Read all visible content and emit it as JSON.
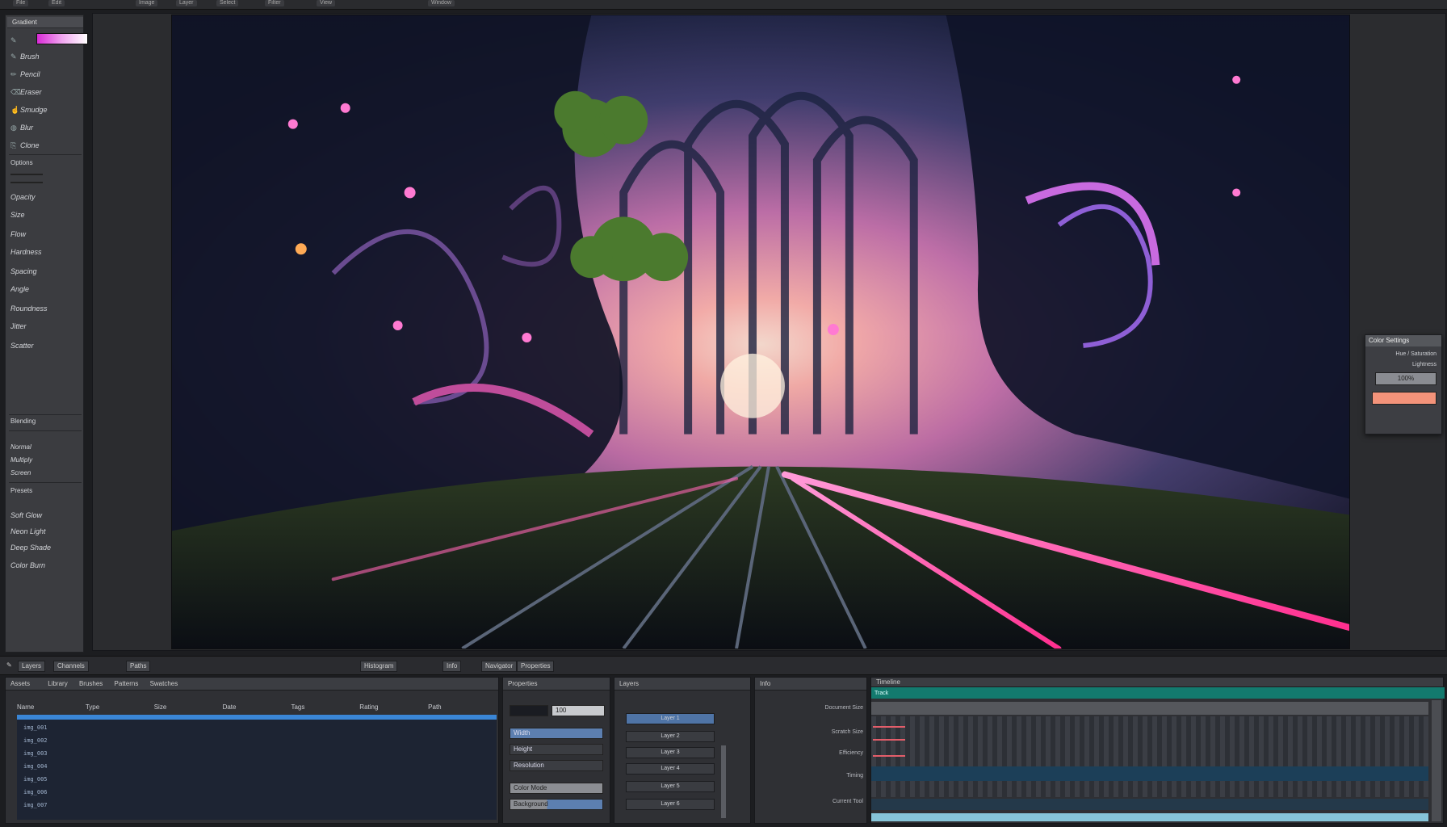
{
  "menubar": {
    "items": [
      "File",
      "Edit",
      "Image",
      "Layer",
      "Select",
      "Filter",
      "View",
      "Window"
    ]
  },
  "left_panel": {
    "header": "Gradient",
    "tools": [
      {
        "icon": "brush-icon",
        "label": "Brush"
      },
      {
        "icon": "pencil-icon",
        "label": "Pencil"
      },
      {
        "icon": "eraser-icon",
        "label": "Eraser"
      },
      {
        "icon": "smudge-icon",
        "label": "Smudge"
      },
      {
        "icon": "blur-icon",
        "label": "Blur"
      },
      {
        "icon": "clone-icon",
        "label": "Clone"
      }
    ],
    "section2_header": "Options",
    "options": [
      "Opacity",
      "Size",
      "Flow",
      "Hardness",
      "Spacing",
      "Angle",
      "Roundness",
      "Jitter",
      "Scatter"
    ],
    "section3_header": "Blending",
    "blend_options": [
      "Normal",
      "Multiply",
      "Screen"
    ],
    "section4_header": "Presets",
    "presets": [
      "Soft Glow",
      "Neon Light",
      "Deep Shade",
      "Color Burn"
    ]
  },
  "dialog": {
    "title": "Color Settings",
    "row1": "Hue / Saturation",
    "row2": "Lightness",
    "value": "100%",
    "swatch_color": "#f4937a"
  },
  "bottom_toolbar": {
    "buttons": [
      "Layers",
      "Channels",
      "Paths",
      "Histogram",
      "Info",
      "Navigator",
      "Properties"
    ]
  },
  "asset_panel": {
    "title": "Assets",
    "tabs": [
      "Library",
      "Brushes",
      "Patterns",
      "Swatches"
    ],
    "columns": [
      "Name",
      "Type",
      "Size",
      "Date",
      "Tags",
      "Rating",
      "Path"
    ],
    "items": [
      "img_001",
      "img_002",
      "img_003",
      "img_004",
      "img_005",
      "img_006",
      "img_007"
    ]
  },
  "prop_panel": {
    "title": "Properties",
    "zoom": "100",
    "fields": [
      "Width",
      "Height",
      "Resolution",
      "Color Mode",
      "Background"
    ]
  },
  "layer_panel": {
    "title": "Layers",
    "buttons": [
      "Layer 1",
      "Layer 2",
      "Layer 3",
      "Layer 4",
      "Layer 5",
      "Layer 6"
    ]
  },
  "info_panel": {
    "title": "Info",
    "rows": [
      "Document Size",
      "Scratch Size",
      "Efficiency",
      "Timing",
      "Current Tool"
    ]
  },
  "timeline_panel": {
    "title": "Timeline",
    "track_label": "Track"
  },
  "colors": {
    "accent_blue": "#3a86d6",
    "timeline_teal": "#137a6e",
    "gradient_magenta": "#d92bd6"
  }
}
